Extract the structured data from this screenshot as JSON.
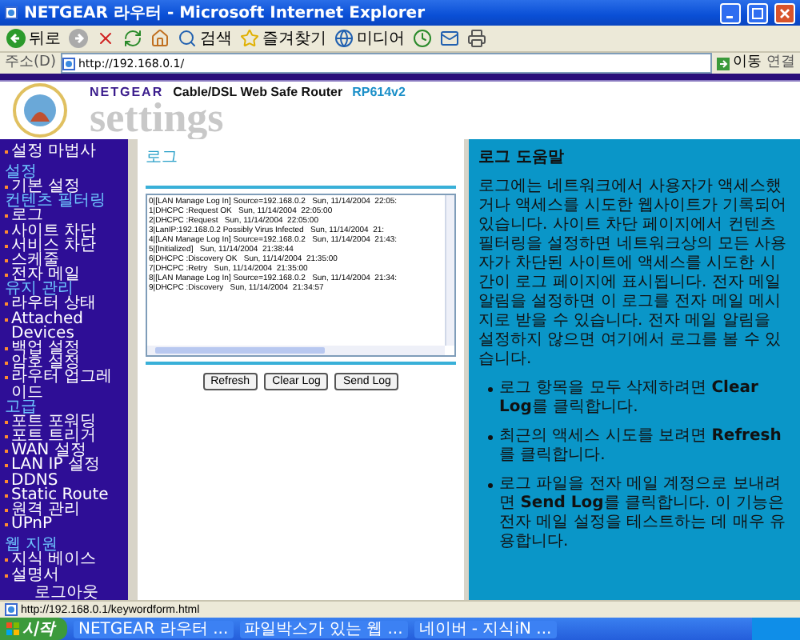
{
  "window": {
    "title": "NETGEAR 라우터 - Microsoft Internet Explorer"
  },
  "toolbar": {
    "buttons": [
      {
        "kind": "back",
        "label": "뒤로"
      },
      {
        "kind": "forward"
      },
      {
        "kind": "stop"
      },
      {
        "kind": "refresh"
      },
      {
        "kind": "home"
      },
      {
        "kind": "search",
        "label": "검색"
      },
      {
        "kind": "favorites",
        "label": "즐겨찾기"
      },
      {
        "kind": "media",
        "label": "미디어"
      },
      {
        "kind": "history"
      },
      {
        "kind": "mail"
      },
      {
        "kind": "print"
      }
    ]
  },
  "address": {
    "label": "주소(D)",
    "value": "http://192.168.0.1/",
    "go": "이동",
    "links": "연결"
  },
  "header": {
    "brand": "NETGEAR",
    "product": "Cable/DSL Web Safe Router",
    "model": "RP614v2",
    "title": "settings"
  },
  "sidebar": {
    "items": [
      {
        "kind": "link",
        "label": "설정 마법사"
      },
      {
        "kind": "divider"
      },
      {
        "kind": "heading",
        "label": "설정"
      },
      {
        "kind": "link",
        "label": "기본 설정"
      },
      {
        "kind": "heading",
        "label": "컨텐츠 필터링"
      },
      {
        "kind": "link",
        "label": "로그"
      },
      {
        "kind": "link",
        "label": "사이트 차단"
      },
      {
        "kind": "link",
        "label": "서비스 차단"
      },
      {
        "kind": "link",
        "label": "스케줄"
      },
      {
        "kind": "link",
        "label": "전자 메일"
      },
      {
        "kind": "heading",
        "label": "유지 관리"
      },
      {
        "kind": "link",
        "label": "라우터 상태"
      },
      {
        "kind": "link",
        "label": "Attached Devices"
      },
      {
        "kind": "link",
        "label": "백업 설정"
      },
      {
        "kind": "link",
        "label": "암호 설정"
      },
      {
        "kind": "link",
        "label": "라우터 업그레이드"
      },
      {
        "kind": "heading",
        "label": "고급"
      },
      {
        "kind": "link",
        "label": "포트 포워딩"
      },
      {
        "kind": "link",
        "label": "포트 트리거"
      },
      {
        "kind": "link",
        "label": "WAN 설정"
      },
      {
        "kind": "link",
        "label": "LAN IP 설정"
      },
      {
        "kind": "link",
        "label": "DDNS"
      },
      {
        "kind": "link",
        "label": "Static Route"
      },
      {
        "kind": "link",
        "label": "원격 관리"
      },
      {
        "kind": "link",
        "label": "UPnP"
      },
      {
        "kind": "divider"
      },
      {
        "kind": "heading",
        "label": "웹 지원"
      },
      {
        "kind": "link",
        "label": "지식 베이스"
      },
      {
        "kind": "link",
        "label": "설명서"
      },
      {
        "kind": "logout",
        "label": "로그아웃"
      }
    ]
  },
  "main": {
    "title": "로그",
    "log_lines": [
      "0|[LAN Manage Log In] Source=192.168.0.2   Sun, 11/14/2004  22:05:",
      "1|DHCPC :Request OK   Sun, 11/14/2004  22:05:00",
      "2|DHCPC :Request   Sun, 11/14/2004  22:05:00",
      "3|LanIP:192.168.0.2 Possibly Virus Infected   Sun, 11/14/2004  21:",
      "4|[LAN Manage Log In] Source=192.168.0.2   Sun, 11/14/2004  21:43:",
      "5|[Initialized]   Sun, 11/14/2004  21:38:44",
      "6|DHCPC :Discovery OK   Sun, 11/14/2004  21:35:00",
      "7|DHCPC :Retry   Sun, 11/14/2004  21:35:00",
      "8|[LAN Manage Log In] Source=192.168.0.2   Sun, 11/14/2004  21:34:",
      "9|DHCPC :Discovery   Sun, 11/14/2004  21:34:57"
    ],
    "buttons": [
      "Refresh",
      "Clear Log",
      "Send Log"
    ]
  },
  "help": {
    "title": "로그 도움말",
    "paragraph": "로그에는 네트워크에서 사용자가 액세스했거나 액세스를 시도한 웹사이트가 기록되어 있습니다. 사이트 차단 페이지에서 컨텐츠 필터링을 설정하면 네트워크상의 모든 사용자가 차단된 사이트에 액세스를 시도한 시간이 로그 페이지에 표시됩니다. 전자 메일 알림을 설정하면 이 로그를 전자 메일 메시지로 받을 수 있습니다. 전자 메일 알림을 설정하지 않으면 여기에서 로그를 볼 수 있습니다.",
    "bullets": [
      "로그 항목을 모두 삭제하려면 **Clear Log**를 클릭합니다.",
      "최근의 액세스 시도를 보려면 **Refresh**를 클릭합니다.",
      "로그 파일을 전자 메일 계정으로 보내려면 **Send Log**를 클릭합니다. 이 기능은 전자 메일 설정을 테스트하는 데 매우 유용합니다."
    ]
  },
  "status_bar": {
    "text": "http://192.168.0.1/keywordform.html"
  },
  "taskbar": {
    "start": "시작",
    "tasks": [
      "NETGEAR 라우터 ...",
      "파일박스가 있는 웹 ...",
      "네이버 - 지식iN ..."
    ]
  }
}
